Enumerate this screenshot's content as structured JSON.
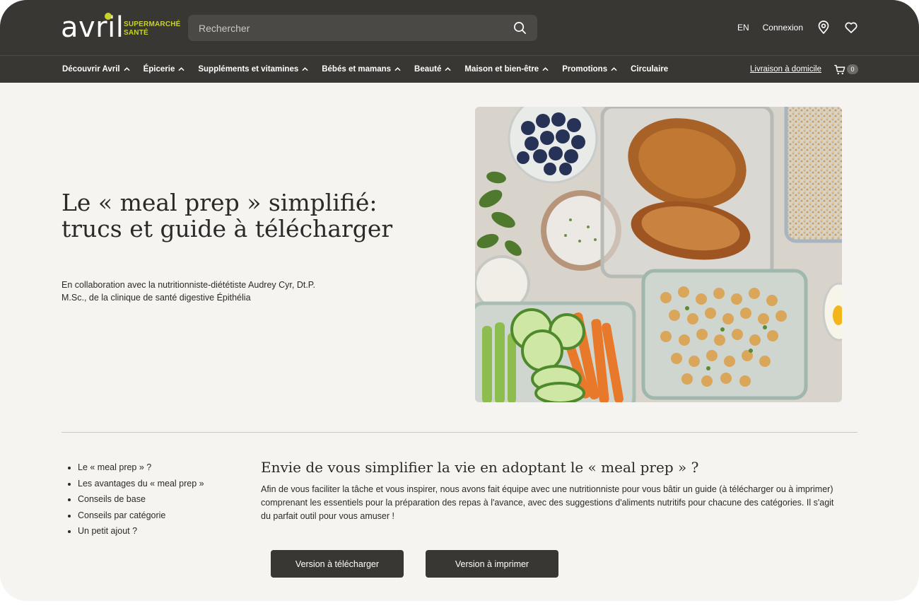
{
  "header": {
    "logo_word": "avril",
    "logo_tagline_1": "SUPERMARCHÉ",
    "logo_tagline_2": "SANTÉ",
    "search_placeholder": "Rechercher",
    "language": "EN",
    "login": "Connexion",
    "icons": [
      "search-icon",
      "location-pin-icon",
      "heart-icon"
    ]
  },
  "nav": {
    "items": [
      {
        "label": "Découvrir Avril"
      },
      {
        "label": "Épicerie"
      },
      {
        "label": "Suppléments et vitamines"
      },
      {
        "label": "Bébés et mamans"
      },
      {
        "label": "Beauté"
      },
      {
        "label": "Maison et bien-être"
      },
      {
        "label": "Promotions"
      },
      {
        "label": "Circulaire"
      }
    ],
    "delivery_link": "Livraison à domicile",
    "cart_count": "0"
  },
  "hero": {
    "title": "Le « meal prep » simplifié: trucs et guide à télécharger",
    "subtitle": "En collaboration avec la nutritionniste-diététiste Audrey Cyr, Dt.P. M.Sc., de la clinique de santé digestive Épithélia"
  },
  "toc": {
    "items": [
      "Le « meal prep » ?",
      "Les avantages du « meal prep »",
      "Conseils de base",
      "Conseils par catégorie",
      "Un petit ajout ?"
    ]
  },
  "section": {
    "title": "Envie de vous simplifier la vie en adoptant le « meal prep » ?",
    "body": "Afin de vous faciliter la tâche et vous inspirer, nous avons fait équipe avec une nutritionniste pour vous bâtir un guide (à télécharger ou à imprimer) comprenant les essentiels pour la préparation des repas à l'avance, avec des suggestions d'aliments nutritifs pour chacune des catégories. Il s'agit du parfait outil pour vous amuser !"
  },
  "buttons": {
    "download": "Version à télécharger",
    "print": "Version à imprimer"
  },
  "colors": {
    "header_bg": "#383734",
    "page_bg": "#f6f4f0",
    "brand_accent": "#c7d22a",
    "text": "#2b2a28"
  }
}
